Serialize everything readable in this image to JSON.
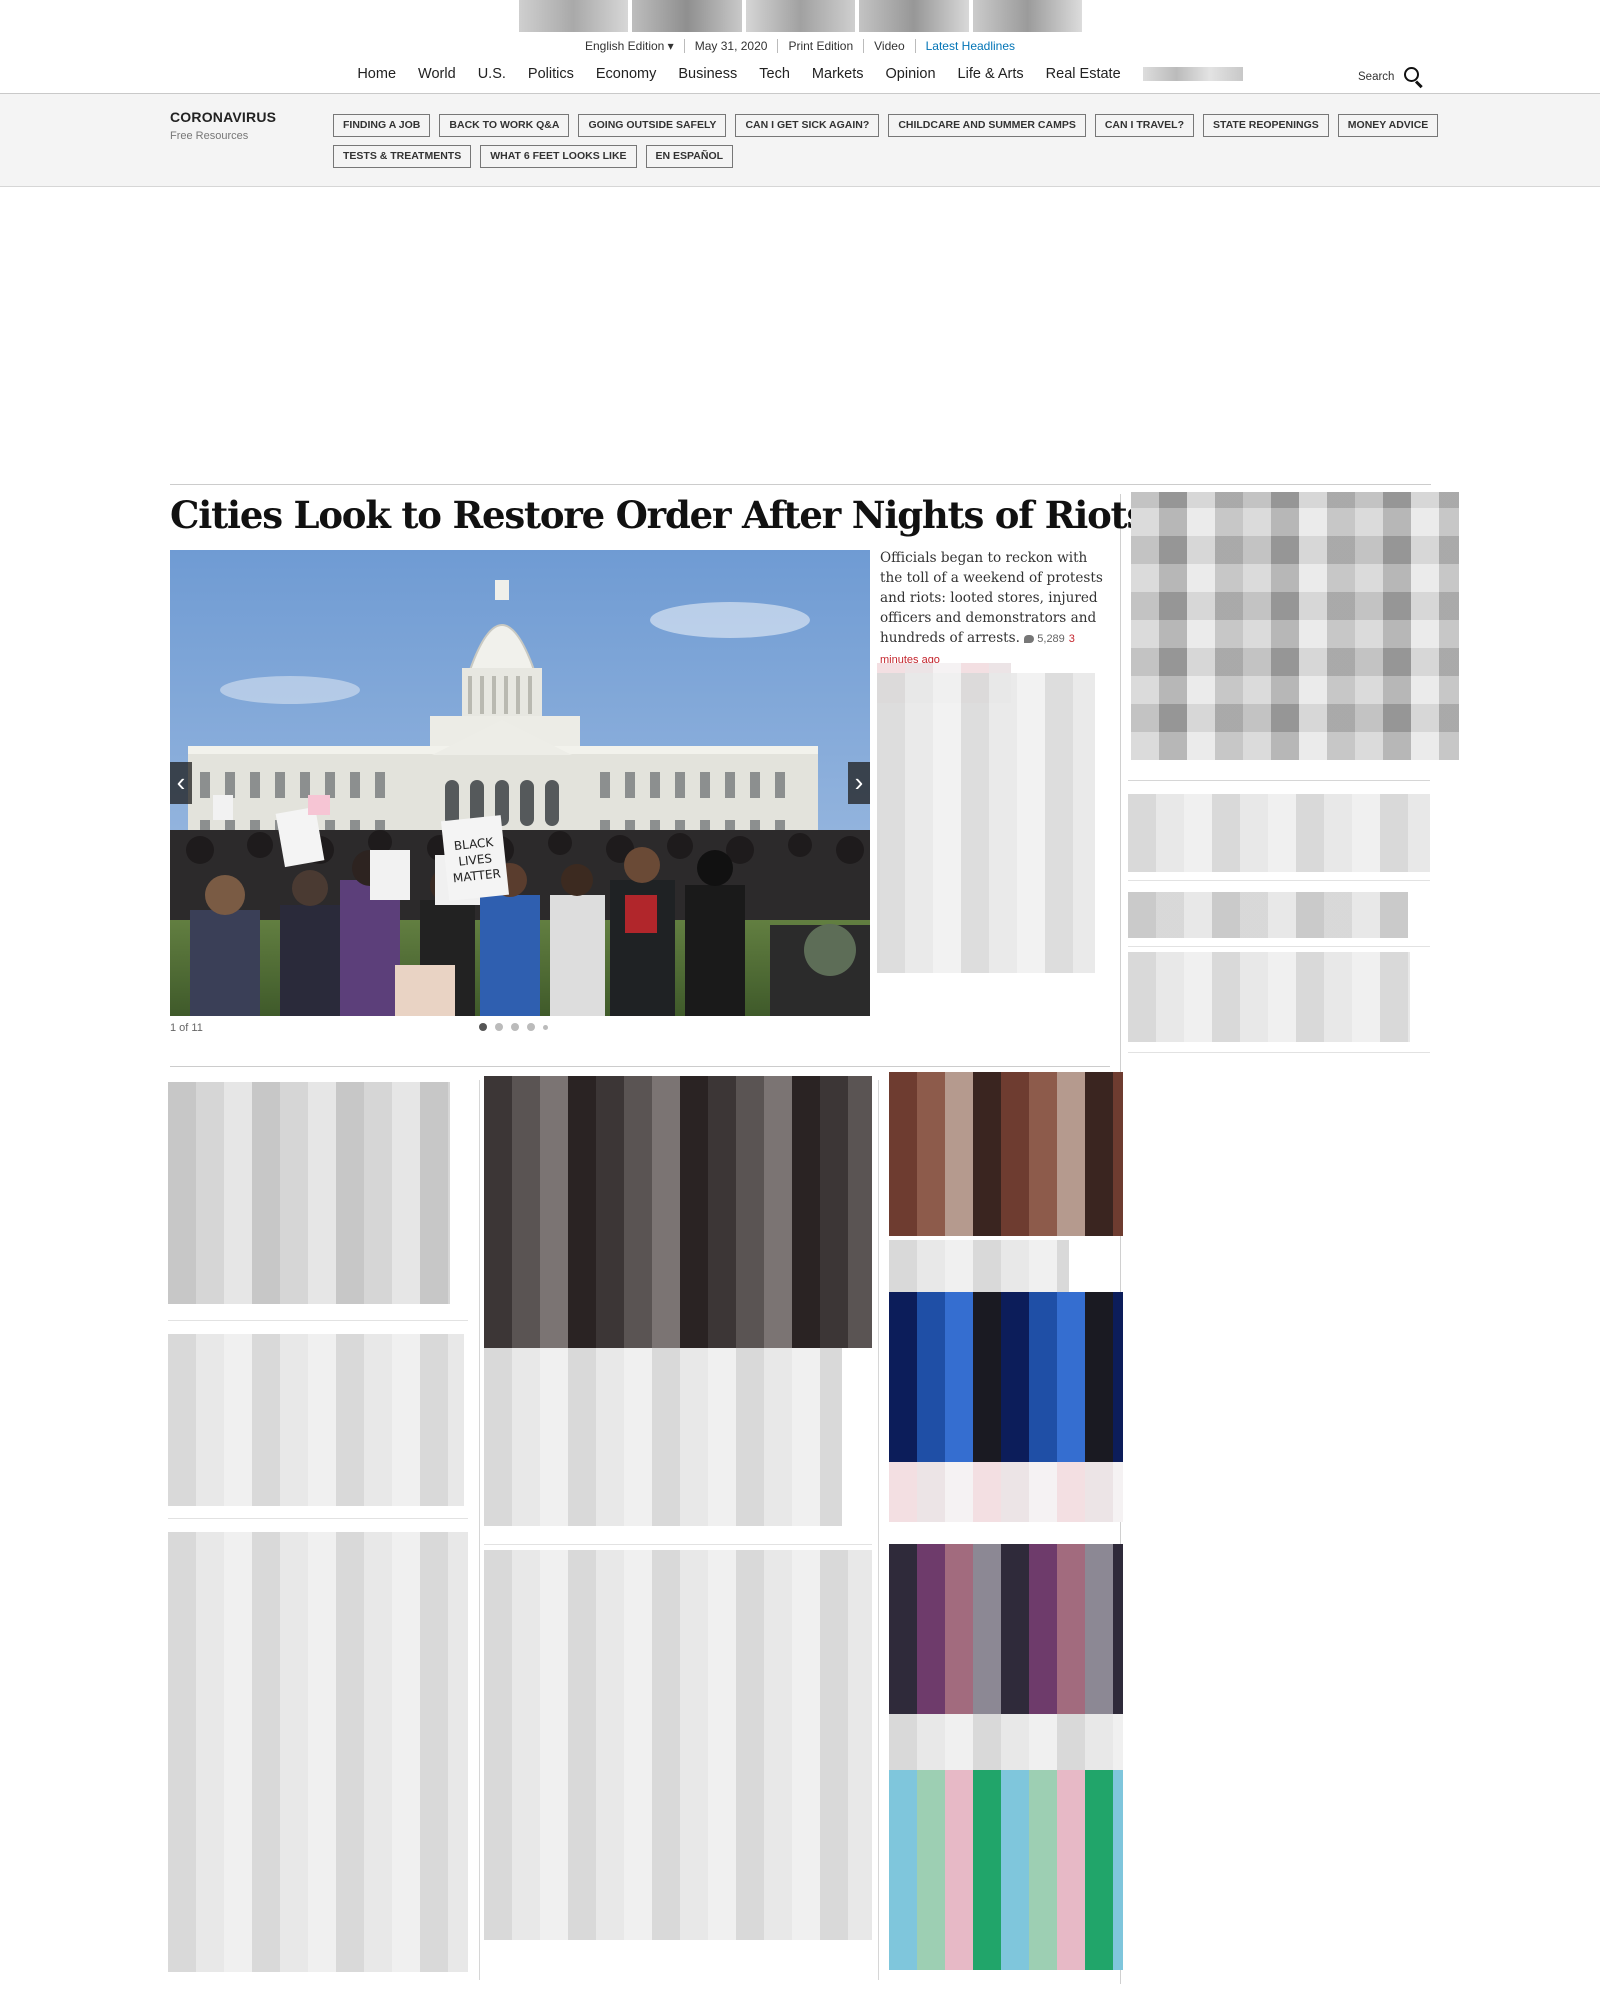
{
  "subnav": {
    "edition": "English Edition ▾",
    "date": "May 31, 2020",
    "print": "Print Edition",
    "video": "Video",
    "latest": "Latest Headlines"
  },
  "nav": {
    "items": [
      "Home",
      "World",
      "U.S.",
      "Politics",
      "Economy",
      "Business",
      "Tech",
      "Markets",
      "Opinion",
      "Life & Arts",
      "Real Estate"
    ],
    "search_label": "Search"
  },
  "corona": {
    "title": "CORONAVIRUS",
    "subtitle": "Free Resources",
    "pills": [
      "FINDING A JOB",
      "BACK TO WORK Q&A",
      "GOING OUTSIDE SAFELY",
      "CAN I GET SICK AGAIN?",
      "CHILDCARE AND SUMMER CAMPS",
      "CAN I TRAVEL?",
      "STATE REOPENINGS",
      "MONEY ADVICE",
      "TESTS & TREATMENTS",
      "WHAT 6 FEET LOOKS LIKE",
      "EN ESPAÑOL"
    ]
  },
  "lead": {
    "headline": "Cities Look to Restore Order After Nights of Riots",
    "summary": "Officials began to reckon with the toll of a weekend of protests and riots: looted stores, injured officers and demonstrators and hundreds of arrests.",
    "comments": "5,289",
    "time_ago": "3 minutes ago",
    "slide_counter": "1 of 11",
    "sign_text": "BLACK LIVES MATTER",
    "slide_index": 1,
    "slide_total": 11
  },
  "colors": {
    "latest_link": "#0274b6",
    "time_ago": "#c4262e",
    "sky": "#7fa4d6"
  }
}
